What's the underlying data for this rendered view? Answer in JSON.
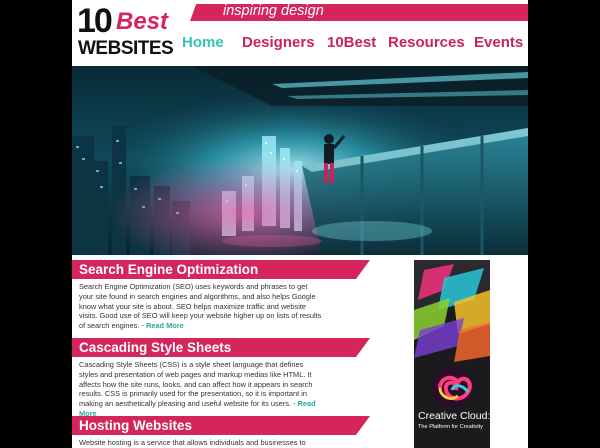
{
  "logo": {
    "top": "10",
    "accent": "Best",
    "bottom": "WEBSITES"
  },
  "tagline": "inspiring design",
  "nav": [
    {
      "label": "Home",
      "active": true
    },
    {
      "label": "Designers",
      "active": false
    },
    {
      "label": "10Best",
      "active": false
    },
    {
      "label": "Resources",
      "active": false
    },
    {
      "label": "Events",
      "active": false
    }
  ],
  "colors": {
    "brand": "#d4265c",
    "active_nav": "#36c1b5",
    "link": "#2aa89c"
  },
  "sections": [
    {
      "title": "Search Engine Optimization",
      "body": "Search Engine Optimization (SEO) uses keywords and phrases to get your site found in search engines and algorithms, and also helps Google know what your site is about. SEO helps maximize traffic and website visits. Good use of SEO will keep your website higher up on lists of results of search engines. - ",
      "more": "Read More"
    },
    {
      "title": "Cascading Style Sheets",
      "body": "Cascading Style Sheets (CSS) is a style sheet language that defines styles and presentation of web pages and markup medias like HTML. It affects how the site runs, looks, and can affect how it appears in search results. CSS is primarily used for the presentation, so it is important in making an aesthetically pleasing and useful website for its users. - ",
      "more": "Read More"
    },
    {
      "title": "Hosting Websites",
      "body": "Website hosting is a service that allows individuals and businesses to",
      "more": ""
    }
  ],
  "ad": {
    "title": "Creative Cloud:",
    "subtitle": "The Platform for Creativity"
  }
}
